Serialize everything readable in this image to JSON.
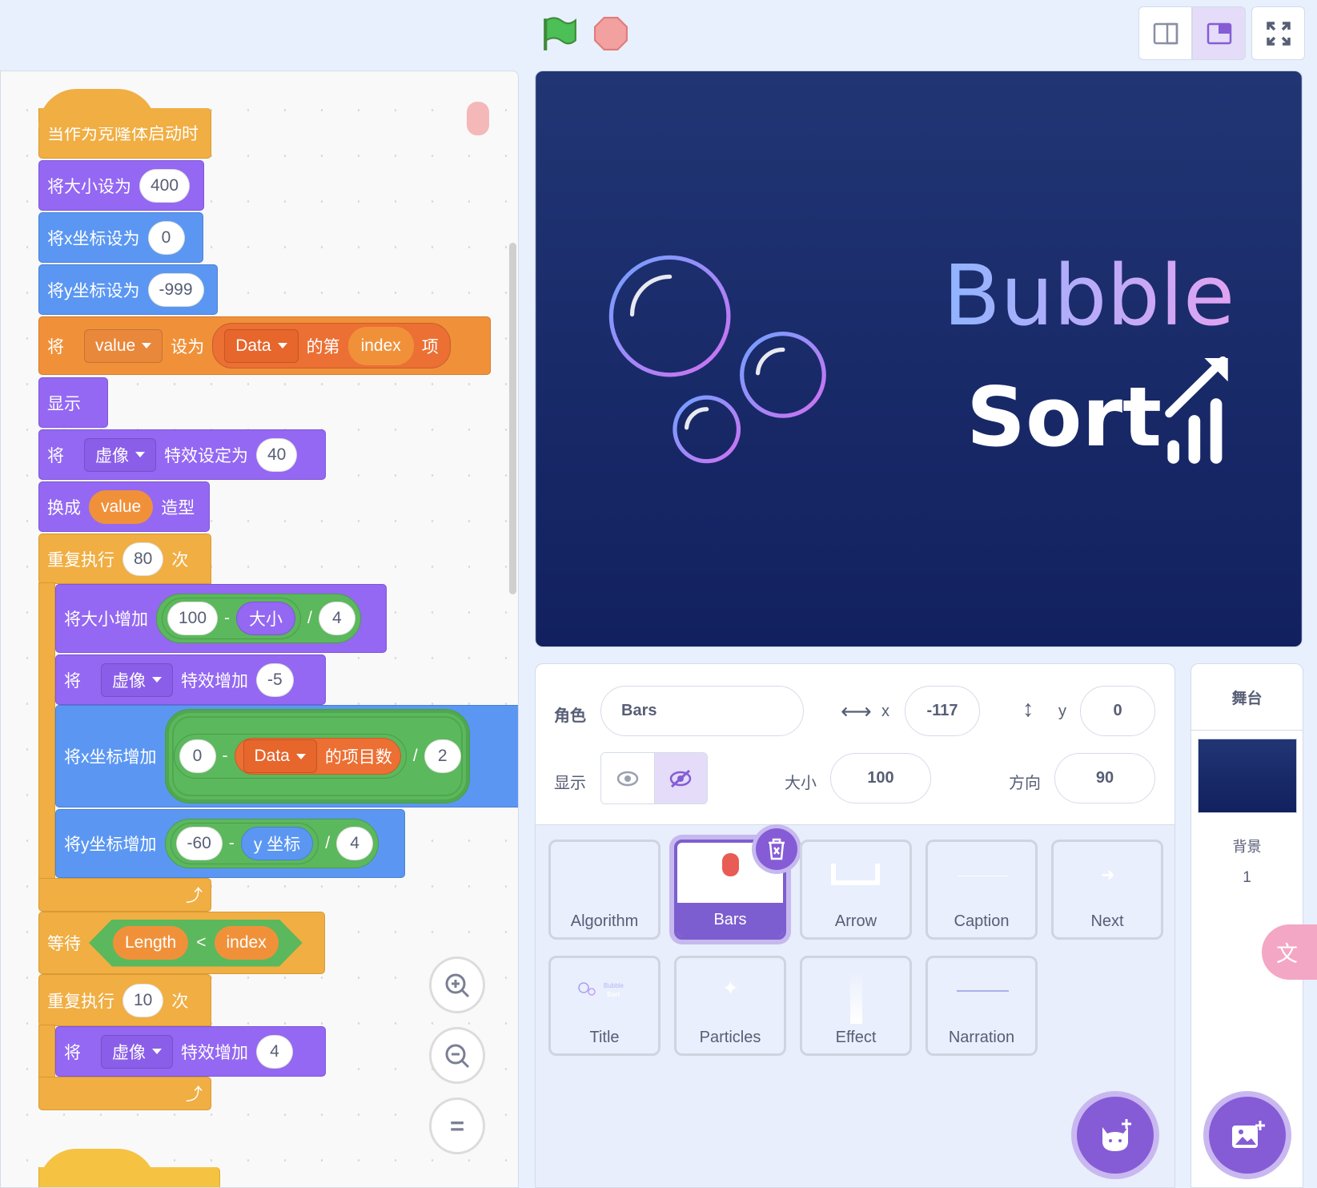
{
  "toolbar": {
    "green_flag": "flag-icon",
    "stop": "stop-icon",
    "layouts": [
      "small-stage",
      "normal-stage"
    ],
    "selected_layout": "normal-stage",
    "fullscreen": "fullscreen-icon"
  },
  "code": {
    "hat": "当作为克隆体启动时",
    "b1": {
      "label": "将大小设为",
      "value": "400"
    },
    "b2": {
      "label": "将x坐标设为",
      "value": "0"
    },
    "b3": {
      "label": "将y坐标设为",
      "value": "-999"
    },
    "b4": {
      "w1": "将",
      "var": "value",
      "w2": "设为",
      "list": "Data",
      "w3": "的第",
      "index": "index",
      "w4": "项"
    },
    "b5": {
      "label": "显示"
    },
    "b6": {
      "w1": "将",
      "effect": "虚像",
      "w2": "特效设定为",
      "value": "40"
    },
    "b7": {
      "w1": "换成",
      "var": "value",
      "w2": "造型"
    },
    "r1": {
      "w1": "重复执行",
      "value": "80",
      "w2": "次"
    },
    "i1": {
      "label": "将大小增加",
      "a": "100",
      "minus": "-",
      "b": "大小",
      "div": "/",
      "c": "4"
    },
    "i2": {
      "w1": "将",
      "effect": "虚像",
      "w2": "特效增加",
      "value": "-5"
    },
    "i3": {
      "label": "将x坐标增加",
      "a": "0",
      "minus": "-",
      "list": "Data",
      "b": "的项目数",
      "div": "/",
      "c": "2"
    },
    "i4": {
      "label": "将y坐标增加",
      "a": "-60",
      "minus": "-",
      "b": "y 坐标",
      "div": "/",
      "c": "4"
    },
    "w": {
      "label": "等待",
      "a": "Length",
      "op": "<",
      "b": "index"
    },
    "r2": {
      "w1": "重复执行",
      "value": "10",
      "w2": "次"
    },
    "i5": {
      "w1": "将",
      "effect": "虚像",
      "w2": "特效增加",
      "value": "4"
    },
    "zoom": {
      "in": "zoom-in-icon",
      "out": "zoom-out-icon",
      "reset": "="
    }
  },
  "stage": {
    "title1": "Bubble",
    "title2": "Sort",
    "bg": "#1b2a6b"
  },
  "sprite_info": {
    "sprite_label": "角色",
    "sprite_name": "Bars",
    "x_label": "x",
    "x": "-117",
    "y_label": "y",
    "y": "0",
    "show_label": "显示",
    "visible": false,
    "size_label": "大小",
    "size": "100",
    "direction_label": "方向",
    "direction": "90"
  },
  "sprites": [
    {
      "name": "Algorithm"
    },
    {
      "name": "Bars",
      "selected": true
    },
    {
      "name": "Arrow"
    },
    {
      "name": "Caption"
    },
    {
      "name": "Next"
    },
    {
      "name": "Title"
    },
    {
      "name": "Particles"
    },
    {
      "name": "Effect"
    },
    {
      "name": "Narration"
    }
  ],
  "stage_panel": {
    "header": "舞台",
    "backdrop_label": "背景",
    "backdrop_count": "1"
  },
  "colors": {
    "accent": "#855cd6",
    "control": "#f0ae43",
    "looks": "#9468f2",
    "motion": "#5b97f2",
    "variables": "#f0913a",
    "lists": "#ec6f33",
    "operators": "#5cb85c"
  }
}
